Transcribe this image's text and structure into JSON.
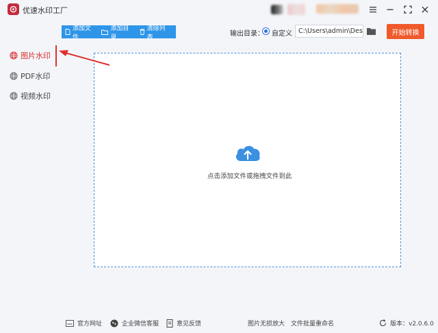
{
  "app": {
    "title": "优速水印工厂"
  },
  "sidebar": {
    "items": [
      {
        "label": "图片水印",
        "active": true
      },
      {
        "label": "PDF水印",
        "active": false
      },
      {
        "label": "视频水印",
        "active": false
      }
    ]
  },
  "toolbar": {
    "add_file": "添加文件",
    "add_folder": "添加目录",
    "clear_list": "清除列表"
  },
  "output": {
    "label": "输出目录：",
    "option": "自定义",
    "path": "C:\\Users\\admin\\Desktop"
  },
  "start_button": "开始转换",
  "dropzone": {
    "hint": "点击添加文件或拖拽文件到此"
  },
  "footer": {
    "website": "官方网址",
    "wechat": "企业微信客服",
    "feedback": "意见反馈",
    "lossless": "图片无损放大",
    "rename": "文件批量重命名",
    "version": "版本：v2.0.6.0"
  },
  "colors": {
    "accent_blue": "#2e95e8",
    "start_orange": "#f0592b",
    "active_red": "#d9302d",
    "background": "#f3f5f9"
  }
}
